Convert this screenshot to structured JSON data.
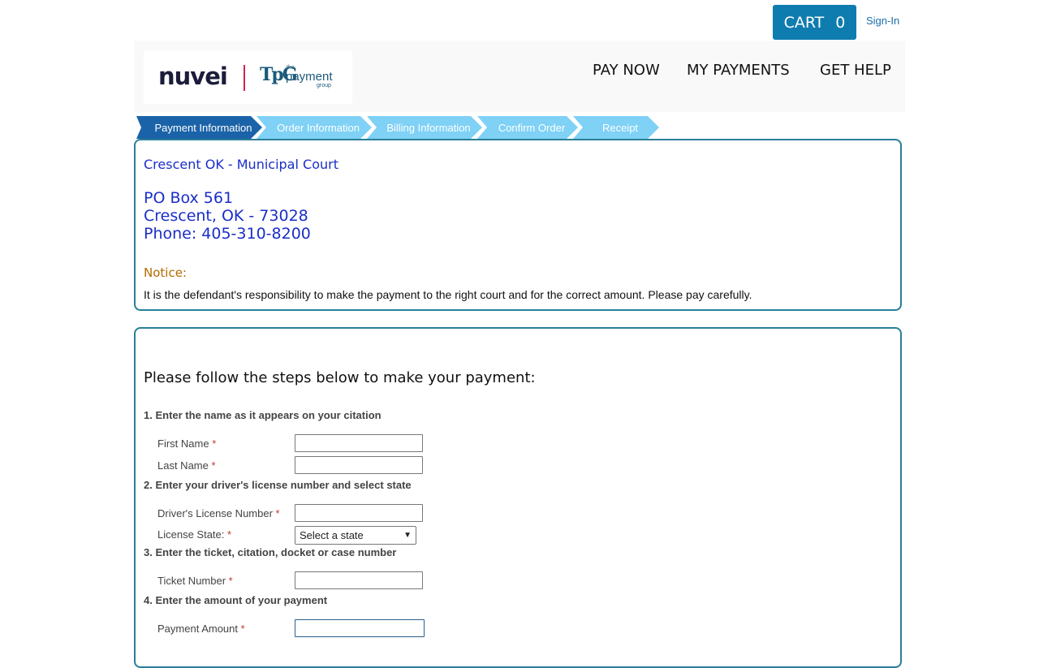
{
  "topbar": {
    "cart_label": "CART",
    "cart_count": "0",
    "signin_label": "Sign-In"
  },
  "logo": {
    "nuvei": "nuvei",
    "tpg_mark": "TpG",
    "tpg_the": "the",
    "tpg_payment": "payment",
    "tpg_group": "group"
  },
  "nav": {
    "pay_now": "PAY NOW",
    "my_payments": "MY PAYMENTS",
    "get_help": "GET HELP"
  },
  "steps": [
    {
      "label": "Payment Information",
      "color": "#1b63a8",
      "active": true
    },
    {
      "label": "Order Information",
      "color": "#7fd1f5"
    },
    {
      "label": "Billing Information",
      "color": "#7fd1f5"
    },
    {
      "label": "Confirm Order",
      "color": "#7fd1f5"
    },
    {
      "label": "Receipt",
      "color": "#7fd1f5"
    }
  ],
  "court": {
    "name": "Crescent OK - Municipal Court",
    "address_line1": "PO Box 561",
    "address_line2": "Crescent, OK - 73028",
    "phone": "Phone: 405-310-8200",
    "notice_label": "Notice:",
    "notice_text": "It is the defendant's responsibility to make the payment to the right court and for the correct amount. Please pay carefully."
  },
  "form": {
    "title": "Please follow the steps below to make your payment:",
    "section1": "1. Enter the name as it appears on your citation",
    "first_name_label": "First Name",
    "last_name_label": "Last Name",
    "section2": "2. Enter your driver's license number and select state",
    "license_label": "Driver's License Number",
    "state_label": "License State:",
    "state_select": "Select a state",
    "section3": "3. Enter the ticket, citation, docket or case number",
    "ticket_label": "Ticket Number",
    "section4": "4. Enter the amount of your payment",
    "amount_label": "Payment Amount",
    "required_mark": "*"
  },
  "colors": {
    "accent": "#0f7cb0",
    "panel_border": "#2a7f98",
    "court_text": "#1a2ec8",
    "notice": "#b36a00",
    "step_active": "#1b63a8",
    "step_inactive": "#7fd1f5"
  }
}
